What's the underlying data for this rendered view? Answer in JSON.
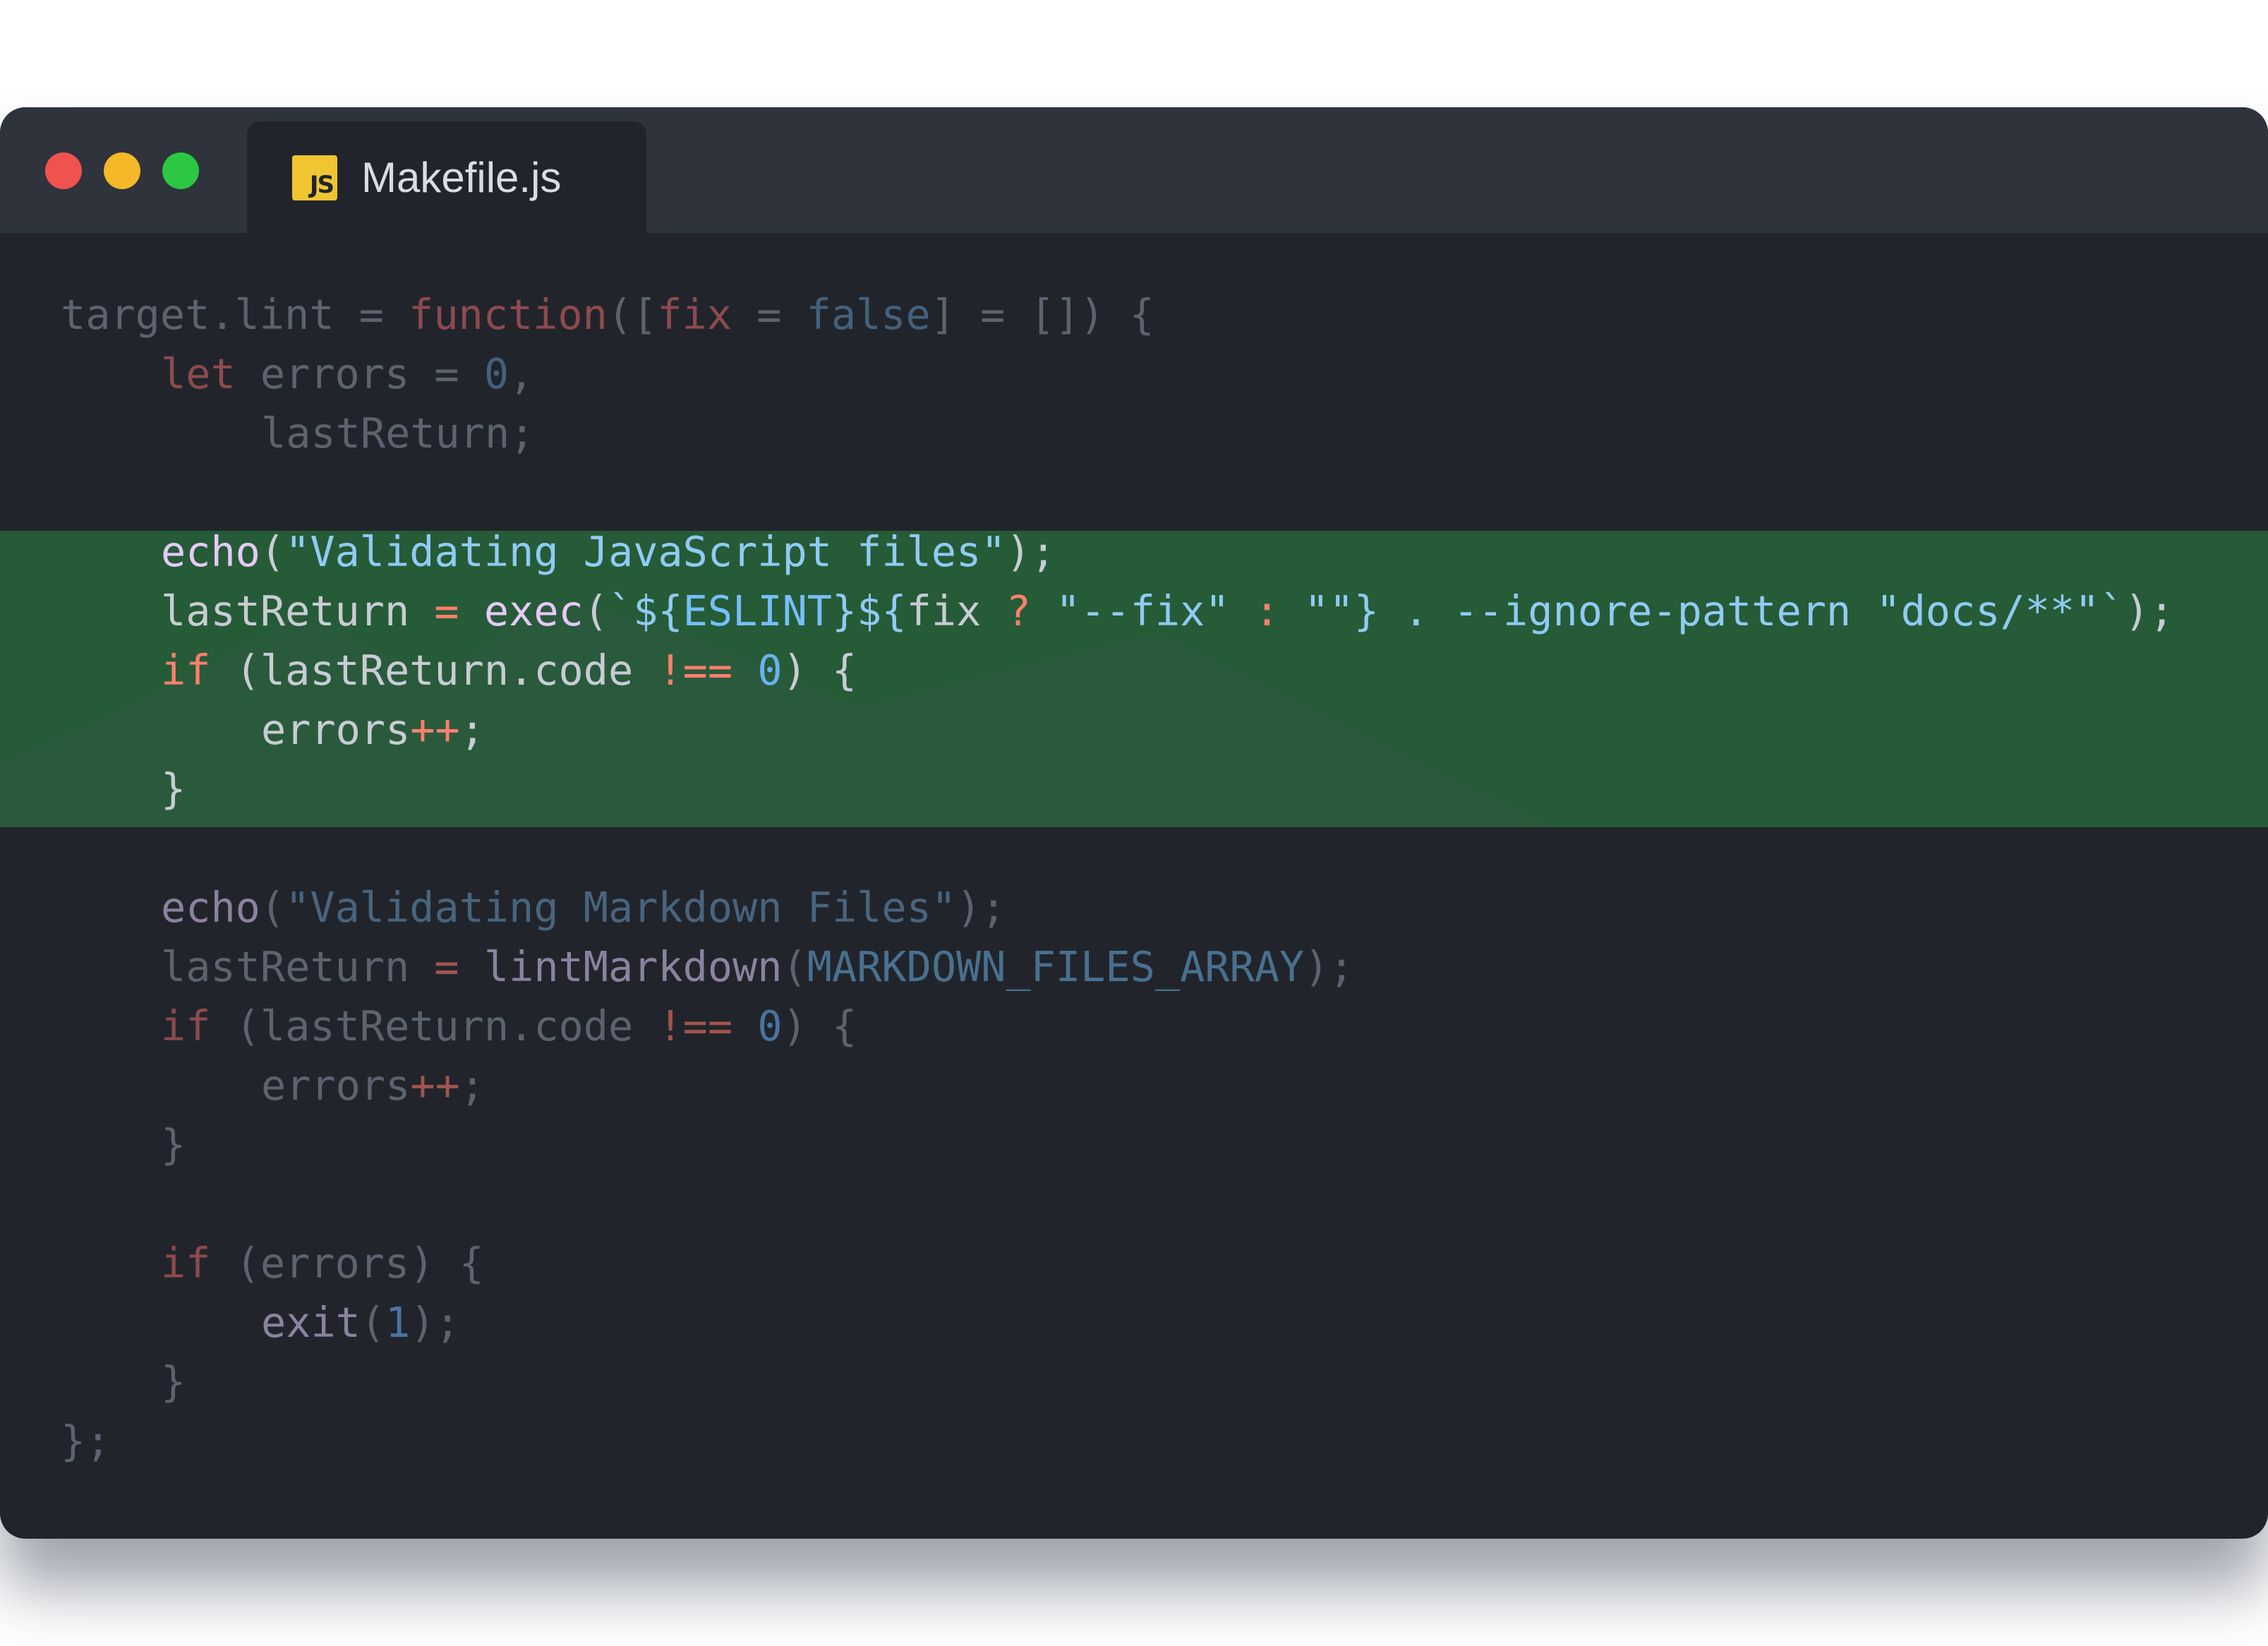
{
  "window": {
    "tab": {
      "icon": "js-file-icon",
      "icon_text": "JS",
      "title": "Makefile.js"
    },
    "colors": {
      "close": "#f0524f",
      "minimize": "#f5b829",
      "maximize": "#2cc843",
      "highlight": "#265b37"
    }
  },
  "code": {
    "lines": [
      "target.lint = function([fix = false] = []) {",
      "    let errors = 0,",
      "        lastReturn;",
      "",
      "    echo(\"Validating JavaScript files\");",
      "    lastReturn = exec(`${ESLINT}${fix ? \"--fix\" : \"\"} . --ignore-pattern \"docs/**\"`);",
      "    if (lastReturn.code !== 0) {",
      "        errors++;",
      "    }",
      "",
      "    echo(\"Validating Markdown Files\");",
      "    lastReturn = lintMarkdown(MARKDOWN_FILES_ARRAY);",
      "    if (lastReturn.code !== 0) {",
      "        errors++;",
      "    }",
      "",
      "    if (errors) {",
      "        exit(1);",
      "    }",
      "};"
    ],
    "highlighted_lines": [
      5,
      9
    ]
  }
}
